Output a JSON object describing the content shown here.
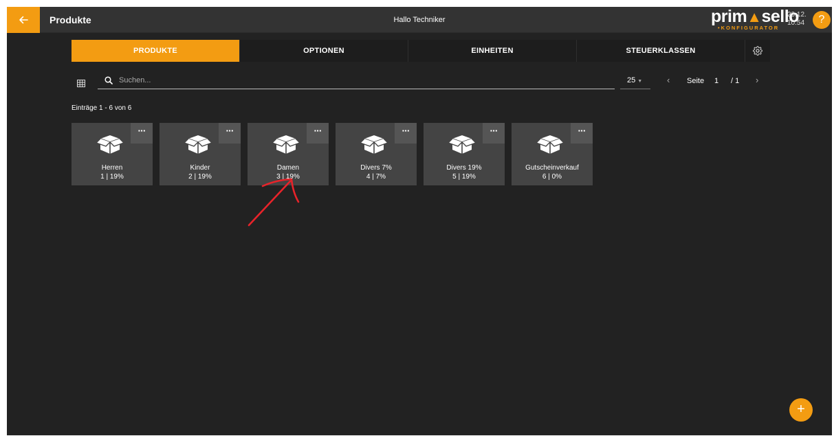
{
  "header": {
    "back_icon": "arrow-left-icon",
    "title": "Produkte",
    "greeting": "Hallo Techniker",
    "logo_main_left": "prim",
    "logo_main_right": "sello",
    "logo_sub": "•KONFIGURATOR",
    "clock_date": "23.12.",
    "clock_time": "10:54",
    "help_label": "?",
    "accent_color": "#f39c12"
  },
  "tabs": [
    {
      "label": "PRODUKTE",
      "active": true
    },
    {
      "label": "OPTIONEN",
      "active": false
    },
    {
      "label": "EINHEITEN",
      "active": false
    },
    {
      "label": "STEUERKLASSEN",
      "active": false
    }
  ],
  "tab_settings_icon": "gear-icon",
  "toolbar": {
    "view_icon": "grid-view-icon",
    "search_icon": "search-icon",
    "search_placeholder": "Suchen...",
    "search_value": "",
    "per_page": "25",
    "page_label": "Seite",
    "page_current": "1",
    "page_total": "/ 1"
  },
  "entries_info": "Einträge 1 - 6 von 6",
  "tiles": [
    {
      "name": "Herren",
      "sub": "1 | 19%",
      "menu": "···",
      "icon": "box-icon"
    },
    {
      "name": "Kinder",
      "sub": "2 | 19%",
      "menu": "···",
      "icon": "box-icon"
    },
    {
      "name": "Damen",
      "sub": "3 | 19%",
      "menu": "···",
      "icon": "box-icon"
    },
    {
      "name": "Divers 7%",
      "sub": "4 | 7%",
      "menu": "···",
      "icon": "box-icon"
    },
    {
      "name": "Divers 19%",
      "sub": "5 | 19%",
      "menu": "···",
      "icon": "box-icon"
    },
    {
      "name": "Gutscheinverkauf",
      "sub": "6 | 0%",
      "menu": "···",
      "icon": "box-icon"
    }
  ],
  "fab_label": "+",
  "annotation": {
    "type": "red-arrow-icon",
    "color": "#e8232a"
  }
}
